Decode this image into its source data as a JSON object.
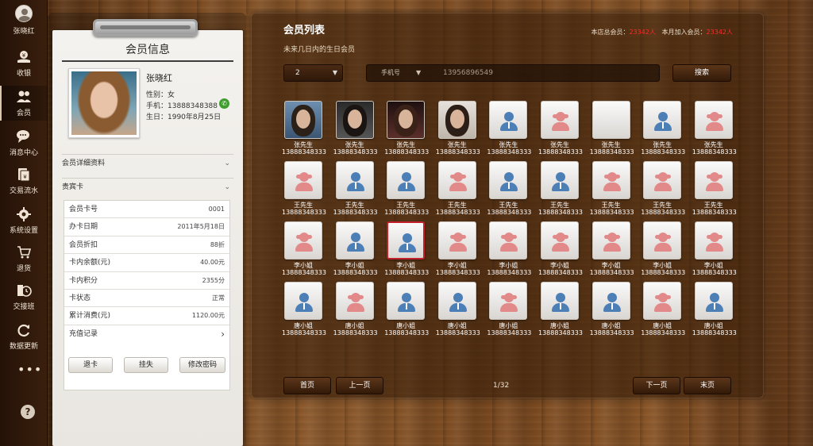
{
  "user": {
    "name": "张晓红"
  },
  "nav": [
    {
      "label": "收银",
      "icon": "cashier-icon"
    },
    {
      "label": "会员",
      "icon": "members-icon"
    },
    {
      "label": "消息中心",
      "icon": "message-icon"
    },
    {
      "label": "交易流水",
      "icon": "transactions-icon"
    },
    {
      "label": "系统设置",
      "icon": "settings-icon"
    },
    {
      "label": "退货",
      "icon": "return-cart-icon"
    },
    {
      "label": "交接班",
      "icon": "shift-clock-icon"
    },
    {
      "label": "数据更新",
      "icon": "refresh-icon"
    }
  ],
  "nav_more": "•••",
  "nav_help": "?",
  "member_card": {
    "title": "会员信息",
    "name": "张晓红",
    "gender": "性别：女",
    "phone_label": "手机：",
    "phone": "13888348388",
    "birthday": "生日：1990年8月25日",
    "detail_section": "会员详细资料",
    "vip_section": "贵宾卡",
    "rows": [
      {
        "label": "会员卡号",
        "value": "0001"
      },
      {
        "label": "办卡日期",
        "value": "2011年5月18日"
      },
      {
        "label": "会员折扣",
        "value": "88折"
      },
      {
        "label": "卡内余额(元)",
        "value": "40.00元"
      },
      {
        "label": "卡内积分",
        "value": "2355分"
      },
      {
        "label": "卡状态",
        "value": "正常"
      },
      {
        "label": "累计消费(元)",
        "value": "1120.00元"
      },
      {
        "label": "充值记录",
        "value": "›"
      }
    ],
    "buttons": {
      "refund": "退卡",
      "suspend": "挂失",
      "change_pwd": "修改密码"
    }
  },
  "panel": {
    "title": "会员列表",
    "subtitle": "未来几日内的生日会员",
    "stats_total_label": "本店总会员：",
    "stats_total": "23342人",
    "stats_month_label": "本月加入会员：",
    "stats_month": "23342人",
    "days_select": "2",
    "search_type": "手机号",
    "search_value": "13956896549",
    "search_button": "搜索"
  },
  "members": [
    {
      "name": "张先生",
      "phone": "13888348333",
      "avatar": "photo"
    },
    {
      "name": "张先生",
      "phone": "13888348333",
      "avatar": "photo"
    },
    {
      "name": "张先生",
      "phone": "13888348333",
      "avatar": "photo"
    },
    {
      "name": "张先生",
      "phone": "13888348333",
      "avatar": "photo"
    },
    {
      "name": "张先生",
      "phone": "13888348333",
      "avatar": "male"
    },
    {
      "name": "张先生",
      "phone": "13888348333",
      "avatar": "female"
    },
    {
      "name": "张先生",
      "phone": "13888348333",
      "avatar": "blank"
    },
    {
      "name": "张先生",
      "phone": "13888348333",
      "avatar": "male"
    },
    {
      "name": "张先生",
      "phone": "13888348333",
      "avatar": "female"
    },
    {
      "name": "王先生",
      "phone": "13888348333",
      "avatar": "female"
    },
    {
      "name": "王先生",
      "phone": "13888348333",
      "avatar": "male"
    },
    {
      "name": "王先生",
      "phone": "13888348333",
      "avatar": "male"
    },
    {
      "name": "王先生",
      "phone": "13888348333",
      "avatar": "female"
    },
    {
      "name": "王先生",
      "phone": "13888348333",
      "avatar": "male"
    },
    {
      "name": "王先生",
      "phone": "13888348333",
      "avatar": "male"
    },
    {
      "name": "王先生",
      "phone": "13888348333",
      "avatar": "female"
    },
    {
      "name": "王先生",
      "phone": "13888348333",
      "avatar": "female"
    },
    {
      "name": "王先生",
      "phone": "13888348333",
      "avatar": "female"
    },
    {
      "name": "李小姐",
      "phone": "13888348333",
      "avatar": "female"
    },
    {
      "name": "李小姐",
      "phone": "13888348333",
      "avatar": "male"
    },
    {
      "name": "李小姐",
      "phone": "13888348333",
      "avatar": "male",
      "selected": true
    },
    {
      "name": "李小姐",
      "phone": "13888348333",
      "avatar": "female"
    },
    {
      "name": "李小姐",
      "phone": "13888348333",
      "avatar": "female"
    },
    {
      "name": "李小姐",
      "phone": "13888348333",
      "avatar": "female"
    },
    {
      "name": "李小姐",
      "phone": "13888348333",
      "avatar": "female"
    },
    {
      "name": "李小姐",
      "phone": "13888348333",
      "avatar": "female"
    },
    {
      "name": "李小姐",
      "phone": "13888348333",
      "avatar": "female"
    },
    {
      "name": "唐小姐",
      "phone": "13888348333",
      "avatar": "male"
    },
    {
      "name": "唐小姐",
      "phone": "13888348333",
      "avatar": "female"
    },
    {
      "name": "唐小姐",
      "phone": "13888348333",
      "avatar": "male"
    },
    {
      "name": "唐小姐",
      "phone": "13888348333",
      "avatar": "male"
    },
    {
      "name": "唐小姐",
      "phone": "13888348333",
      "avatar": "female"
    },
    {
      "name": "唐小姐",
      "phone": "13888348333",
      "avatar": "male"
    },
    {
      "name": "唐小姐",
      "phone": "13888348333",
      "avatar": "male"
    },
    {
      "name": "唐小姐",
      "phone": "13888348333",
      "avatar": "female"
    },
    {
      "name": "唐小姐",
      "phone": "13888348333",
      "avatar": "male"
    }
  ],
  "pager": {
    "first": "首页",
    "prev": "上一页",
    "page": "1/32",
    "next": "下一页",
    "last": "末页"
  },
  "colors": {
    "accent_red": "#ff2a2a",
    "male": "#4d7fb7",
    "female": "#e28a8a",
    "selected_border": "#c2202a"
  }
}
